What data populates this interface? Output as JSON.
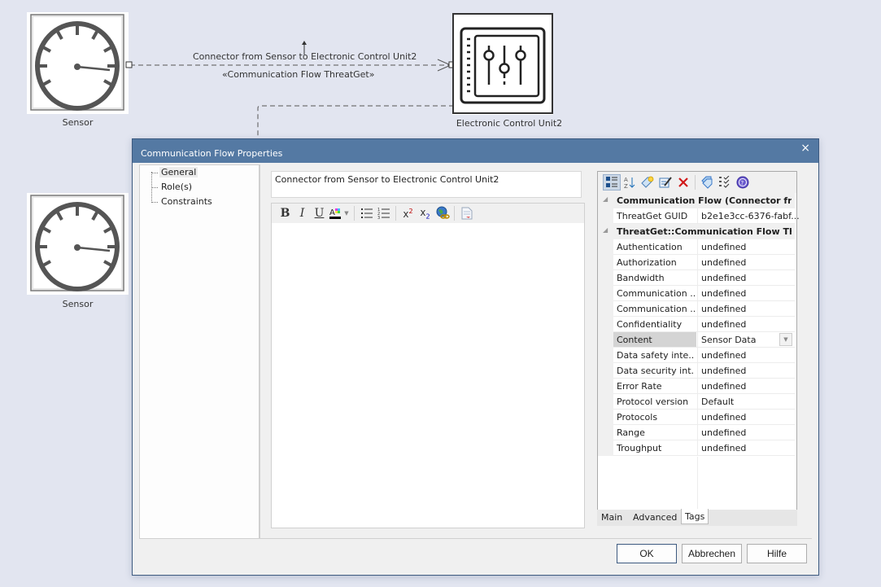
{
  "diagram": {
    "nodes": [
      {
        "label": "Sensor",
        "icon": "gauge-icon"
      },
      {
        "label": "Electronic Control Unit2",
        "icon": "control-panel-icon"
      },
      {
        "label": "Sensor",
        "icon": "gauge-icon"
      }
    ],
    "connector": {
      "name": "Connector from Sensor to Electronic Control Unit2",
      "stereotype": "«Communication Flow ThreatGet»"
    }
  },
  "dialog": {
    "title": "Communication Flow Properties",
    "close_icon": "×",
    "tree": {
      "items": [
        {
          "label": "General",
          "selected": true
        },
        {
          "label": "Role(s)",
          "selected": false
        },
        {
          "label": "Constraints",
          "selected": false
        }
      ]
    },
    "name_field": {
      "value": "Connector from Sensor to Electronic Control Unit2"
    },
    "editor_toolbar": {
      "bold": "B",
      "italic": "I",
      "underline": "U",
      "superscript": "x²",
      "subscript": "x₂"
    },
    "properties": {
      "categories": [
        {
          "title": "Communication Flow (Connector from ...",
          "rows": [
            {
              "key": "ThreatGet GUID",
              "value": "b2e1e3cc-6376-fabf..."
            }
          ]
        },
        {
          "title": "ThreatGet::Communication Flow Threat...",
          "rows": [
            {
              "key": "Authentication",
              "value": "undefined"
            },
            {
              "key": "Authorization",
              "value": "undefined"
            },
            {
              "key": "Bandwidth",
              "value": "undefined"
            },
            {
              "key": "Communication ...",
              "value": "undefined"
            },
            {
              "key": "Communication ...",
              "value": "undefined"
            },
            {
              "key": "Confidentiality",
              "value": "undefined"
            },
            {
              "key": "Content",
              "value": "Sensor Data",
              "selected": true
            },
            {
              "key": "Data safety inte...",
              "value": "undefined"
            },
            {
              "key": "Data security int...",
              "value": "undefined"
            },
            {
              "key": "Error Rate",
              "value": "undefined"
            },
            {
              "key": "Protocol version",
              "value": "Default"
            },
            {
              "key": "Protocols",
              "value": "undefined"
            },
            {
              "key": "Range",
              "value": "undefined"
            },
            {
              "key": "Troughput",
              "value": "undefined"
            }
          ]
        }
      ],
      "tabs": [
        {
          "label": "Main",
          "active": false
        },
        {
          "label": "Advanced",
          "active": false
        },
        {
          "label": "Tags",
          "active": true
        }
      ]
    },
    "buttons": {
      "ok": "OK",
      "cancel": "Abbrechen",
      "help": "Hilfe"
    }
  }
}
